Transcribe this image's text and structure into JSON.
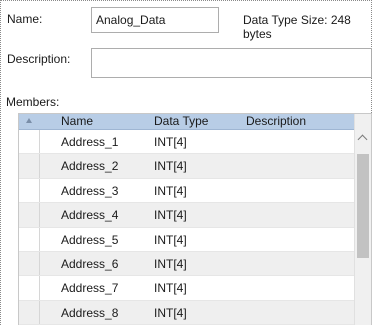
{
  "form": {
    "name_label": "Name:",
    "name_value": "Analog_Data",
    "size_label": "Data Type Size: 248 bytes",
    "description_label": "Description:",
    "description_value": "",
    "members_label": "Members:"
  },
  "members": {
    "columns": [
      "Name",
      "Data Type",
      "Description"
    ],
    "rows": [
      {
        "name": "Address_1",
        "type": "INT[4]",
        "description": ""
      },
      {
        "name": "Address_2",
        "type": "INT[4]",
        "description": ""
      },
      {
        "name": "Address_3",
        "type": "INT[4]",
        "description": ""
      },
      {
        "name": "Address_4",
        "type": "INT[4]",
        "description": ""
      },
      {
        "name": "Address_5",
        "type": "INT[4]",
        "description": ""
      },
      {
        "name": "Address_6",
        "type": "INT[4]",
        "description": ""
      },
      {
        "name": "Address_7",
        "type": "INT[4]",
        "description": ""
      },
      {
        "name": "Address_8",
        "type": "INT[4]",
        "description": ""
      }
    ]
  }
}
